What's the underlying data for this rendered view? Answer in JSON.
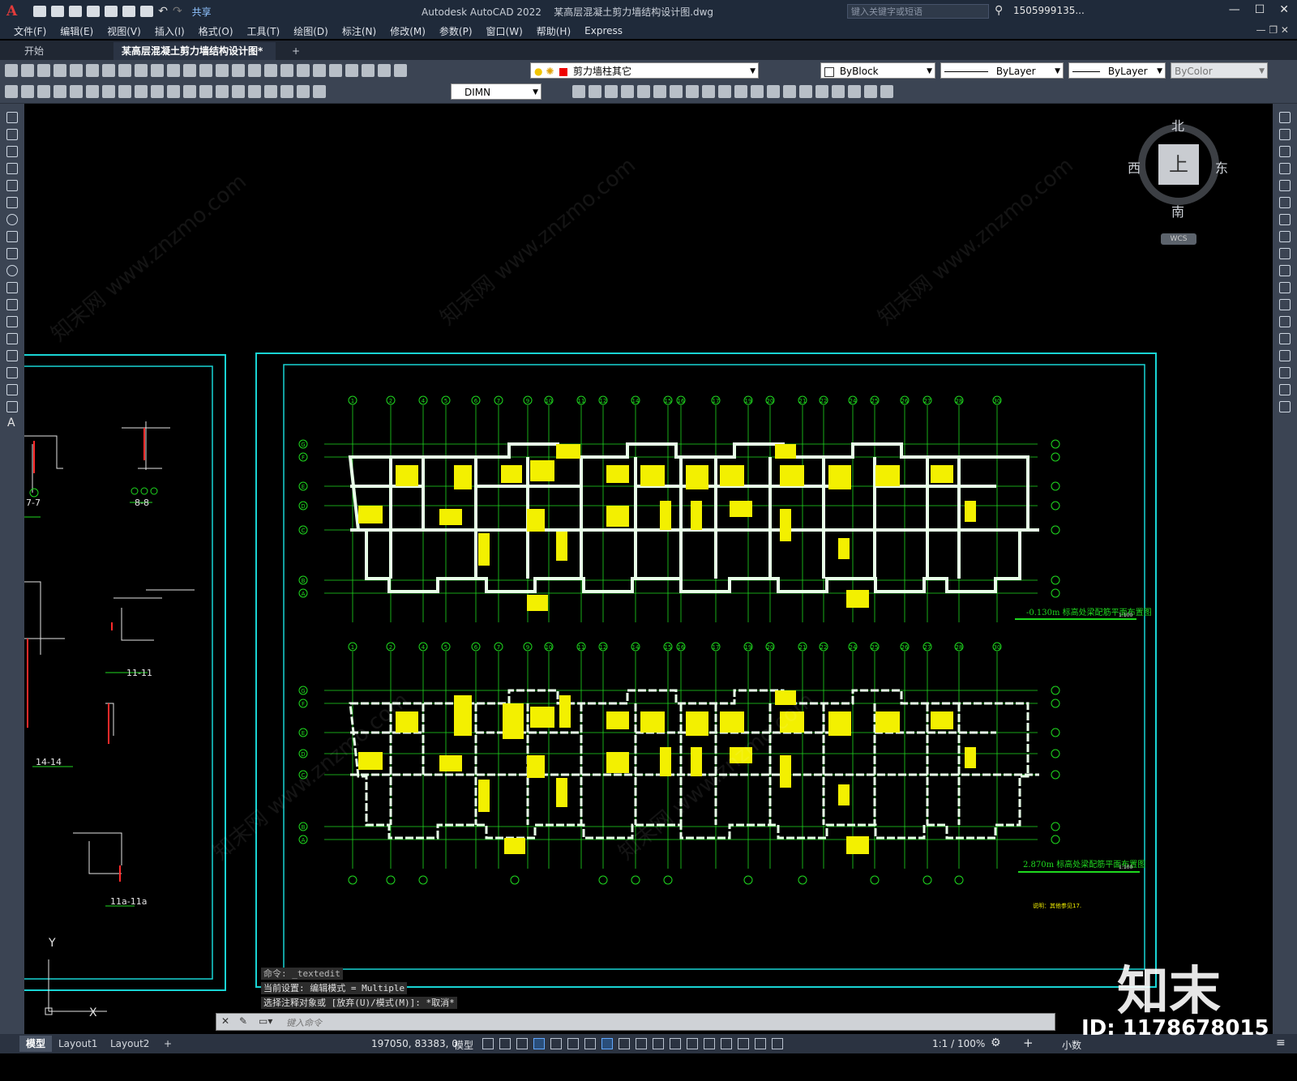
{
  "title": {
    "app": "Autodesk AutoCAD 2022",
    "file": "某高层混凝土剪力墙结构设计图.dwg",
    "share": "共享",
    "search_placeholder": "键入关键字或短语",
    "user": "1505999135..."
  },
  "menu": [
    "文件(F)",
    "编辑(E)",
    "视图(V)",
    "插入(I)",
    "格式(O)",
    "工具(T)",
    "绘图(D)",
    "标注(N)",
    "修改(M)",
    "参数(P)",
    "窗口(W)",
    "帮助(H)",
    "Express"
  ],
  "doc_tabs": {
    "start": "开始",
    "active": "某高层混凝土剪力墙结构设计图*",
    "add": "+"
  },
  "toolbar1": {
    "layer": "剪力墙柱其它",
    "color": "ByBlock",
    "linetype": "ByLayer",
    "lineweight": "ByLayer",
    "plotstyle": "ByColor"
  },
  "toolbar2": {
    "dimstyle": "DIMN"
  },
  "viewcube": {
    "north": "北",
    "south": "南",
    "east": "东",
    "west": "西",
    "face": "上",
    "wcs": "WCS"
  },
  "drawing": {
    "plan1_title": "-0.130m 标高处梁配筋平面布置图",
    "plan1_scale": "1:100",
    "plan2_title": "2.870m 标高处梁配筋平面布置图",
    "plan2_scale": "1:100",
    "note": "说明：其他参见17.",
    "axis_letters": [
      "G",
      "F",
      "E",
      "D",
      "C",
      "B",
      "A"
    ],
    "axis_numbers": [
      "1",
      "2",
      "4",
      "5",
      "6",
      "7",
      "9",
      "10",
      "11",
      "12",
      "14",
      "15",
      "16",
      "17",
      "19",
      "20",
      "21",
      "22",
      "24",
      "25",
      "26",
      "27",
      "28",
      "30"
    ],
    "section_labels": [
      "7-7",
      "8-8",
      "11-11",
      "14-14",
      "11a-11a"
    ],
    "ucs_x": "X",
    "ucs_y": "Y"
  },
  "command": {
    "history": [
      "命令: _textedit",
      "当前设置: 编辑模式 = Multiple",
      "选择注释对象或 [放弃(U)/模式(M)]: *取消*"
    ],
    "placeholder": "键入命令"
  },
  "status": {
    "tabs": [
      "模型",
      "Layout1",
      "Layout2"
    ],
    "coords": "197050, 83383, 0",
    "space": "模型",
    "scale": "1:1 / 100%",
    "units": "小数"
  },
  "watermark": {
    "brand": "知末",
    "id": "ID: 1178678015",
    "site": "知末网 www.znzmo.com"
  }
}
